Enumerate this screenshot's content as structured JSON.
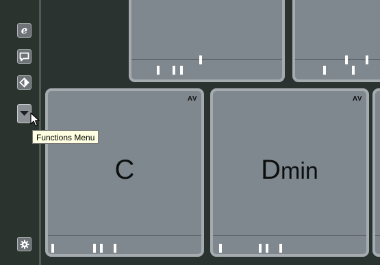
{
  "toolbar": {
    "buttons": [
      {
        "name": "editor-icon",
        "glyph": "e"
      },
      {
        "name": "comment-icon"
      },
      {
        "name": "tag-icon"
      },
      {
        "name": "chevron-down-icon"
      },
      {
        "name": "gear-icon"
      }
    ]
  },
  "tooltip": {
    "text": "Functions Menu"
  },
  "pads": {
    "pad3": {
      "chord": "C",
      "suffix": "",
      "badge": "AV"
    },
    "pad4": {
      "chord": "D",
      "suffix": "min",
      "badge": "AV"
    }
  },
  "colors": {
    "background": "#263029",
    "pad_fill": "#7f888f",
    "pad_border": "#a5abaf",
    "tooltip_bg": "#ffffe1"
  }
}
